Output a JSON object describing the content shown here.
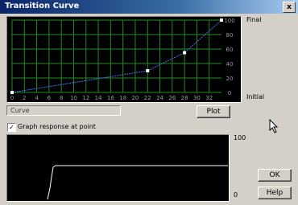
{
  "window": {
    "title": "Transition Curve",
    "close_glyph": "x"
  },
  "curve": {
    "x_ticks": [
      "0",
      "2",
      "4",
      "6",
      "8",
      "10",
      "12",
      "14",
      "16",
      "18",
      "20",
      "22",
      "24",
      "26",
      "28",
      "30",
      "32"
    ],
    "y_ticks": [
      "0",
      "20",
      "40",
      "60",
      "80",
      "100"
    ],
    "label_final": "Final",
    "label_initial": "Initial",
    "points": [
      [
        0,
        0
      ],
      [
        22,
        30
      ],
      [
        28,
        55
      ],
      [
        34,
        100
      ]
    ],
    "line_color": "#4a6cff",
    "grid_color": "#1f8f1f"
  },
  "status_text": "Curve",
  "buttons": {
    "plot": "Plot",
    "ok": "OK",
    "help": "Help"
  },
  "graph_checkbox": {
    "checked": true,
    "label": "Graph response at point"
  },
  "response": {
    "label_top": "100",
    "label_bottom": "0",
    "line_color": "#ffffff"
  }
}
